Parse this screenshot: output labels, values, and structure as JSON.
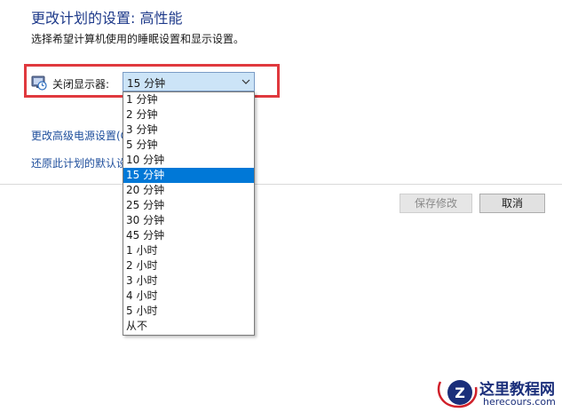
{
  "page": {
    "title": "更改计划的设置: 高性能",
    "subtitle": "选择希望计算机使用的睡眠设置和显示设置。"
  },
  "setting": {
    "label": "关闭显示器:",
    "selected": "15 分钟",
    "icon": "display-power-icon",
    "options": [
      "1 分钟",
      "2 分钟",
      "3 分钟",
      "5 分钟",
      "10 分钟",
      "15 分钟",
      "20 分钟",
      "25 分钟",
      "30 分钟",
      "45 分钟",
      "1 小时",
      "2 小时",
      "3 小时",
      "4 小时",
      "5 小时",
      "从不"
    ]
  },
  "links": {
    "advanced": "更改高级电源设置(C)",
    "restore": "还原此计划的默认设置(R)"
  },
  "buttons": {
    "save": "保存修改",
    "cancel": "取消"
  },
  "watermark": {
    "text": "这里教程网",
    "url": "herecours.com",
    "logo_letter": "Z"
  },
  "colors": {
    "accent": "#0078d7",
    "highlight_border": "#e0393e",
    "link": "#1e4e9c",
    "title": "#1e3a8a"
  }
}
